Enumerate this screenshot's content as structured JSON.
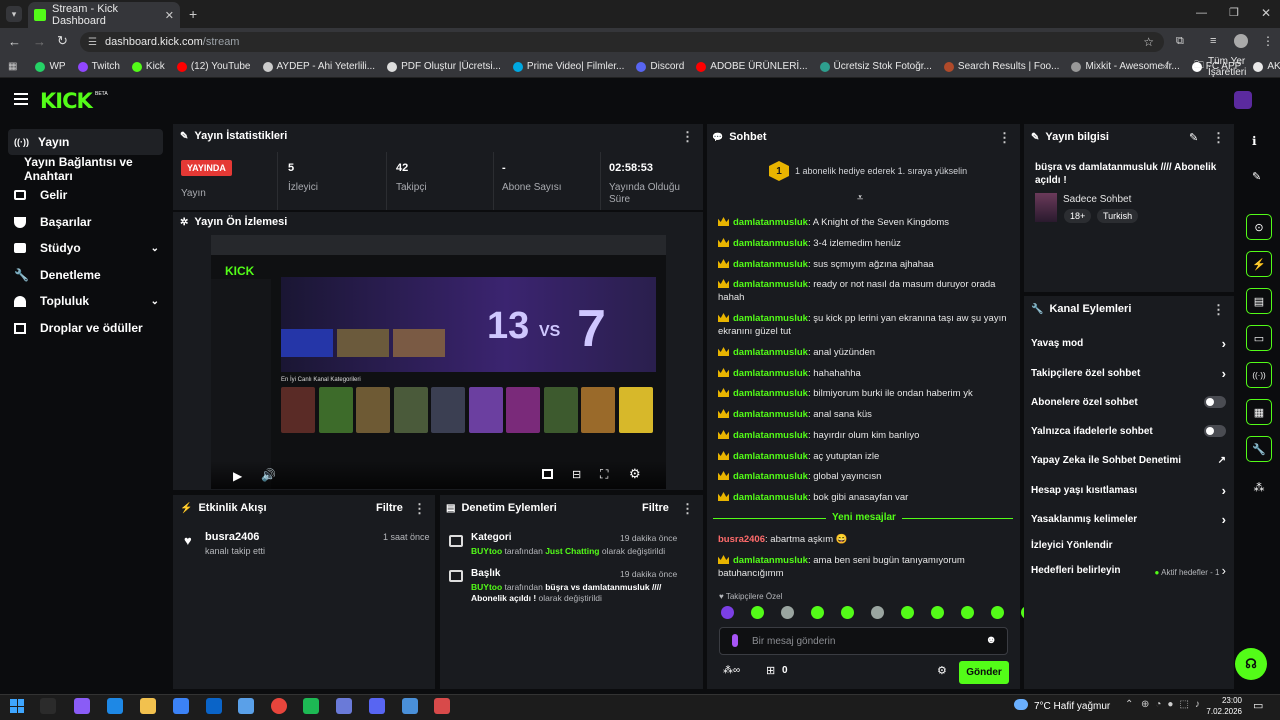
{
  "browser": {
    "tab_title": "Stream - Kick Dashboard",
    "url_domain": "dashboard.kick.com",
    "url_path": "/stream",
    "bookmarks": [
      {
        "label": "WP",
        "color": "#25d366"
      },
      {
        "label": "Twitch",
        "color": "#9146ff"
      },
      {
        "label": "Kick",
        "color": "#53fc18"
      },
      {
        "label": "(12) YouTube",
        "color": "#ff0000"
      },
      {
        "label": "AYDEP - Ahi Yeterlili...",
        "color": "#cccccc"
      },
      {
        "label": "PDF Oluştur |Ücretsi...",
        "color": "#dddddd"
      },
      {
        "label": "Prime Video| Filmler...",
        "color": "#00a8e1"
      },
      {
        "label": "Discord",
        "color": "#5865f2"
      },
      {
        "label": "ADOBE ÜRÜNLERİ...",
        "color": "#ff0000"
      },
      {
        "label": "Ücretsiz Stok Fotoğr...",
        "color": "#2e9e8e"
      },
      {
        "label": "Search Results | Foo...",
        "color": "#b04a2a"
      },
      {
        "label": "Mixkit - Awesome fr...",
        "color": "#999999"
      },
      {
        "label": "FC APP",
        "color": "#ffffff"
      },
      {
        "label": "AKNET",
        "color": "#e8e8e8"
      }
    ],
    "all_bookmarks": "Tüm Yer İşaretleri"
  },
  "brand": {
    "logo": "KICK",
    "beta": "BETA",
    "accent": "#53fc18"
  },
  "sidebar": {
    "items": [
      {
        "label": "Yayın",
        "icon": "broadcast-icon"
      },
      {
        "label": "Yayın Bağlantısı ve Anahtarı",
        "icon": ""
      },
      {
        "label": "Gelir",
        "icon": "revenue-icon"
      },
      {
        "label": "Başarılar",
        "icon": "trophy-icon"
      },
      {
        "label": "Stüdyo",
        "icon": "studio-icon"
      },
      {
        "label": "Denetleme",
        "icon": "wrench-icon"
      },
      {
        "label": "Topluluk",
        "icon": "community-icon"
      },
      {
        "label": "Droplar ve ödüller",
        "icon": "gift-icon"
      }
    ]
  },
  "stats": {
    "title": "Yayın İstatistikleri",
    "live_badge": "YAYINDA",
    "live_label": "Yayın",
    "items": [
      {
        "value": "5",
        "label": "İzleyici"
      },
      {
        "value": "42",
        "label": "Takipçi"
      },
      {
        "value": "-",
        "label": "Abone Sayısı"
      },
      {
        "value": "02:58:53",
        "label": "Yayında Olduğu Süre"
      }
    ]
  },
  "preview": {
    "title": "Yayın Ön İzlemesi",
    "scores": [
      "13",
      "7"
    ],
    "vs": "VS",
    "categories_heading": "En İyi Canlı Kanal Kategorileri"
  },
  "activity": {
    "title": "Etkinlik Akışı",
    "filter": "Filtre",
    "items": [
      {
        "user": "busra2406",
        "text": "kanalı takip etti",
        "time": "1 saat önce"
      }
    ]
  },
  "moderation": {
    "title": "Denetim Eylemleri",
    "filter": "Filtre",
    "items": [
      {
        "title": "Kategori",
        "time": "19 dakika önce",
        "user": "BUYtoo",
        "mid": " tarafından ",
        "value": "Just Chatting",
        "tail": " olarak değiştirildi"
      },
      {
        "title": "Başlık",
        "time": "19 dakika önce",
        "user": "BUYtoo",
        "mid": " tarafından ",
        "value": "büşra vs damlatanmusluk //// Abonelik açıldı !",
        "tail": " olarak değiştirildi"
      }
    ]
  },
  "chat": {
    "title": "Sohbet",
    "gift_rank": "1",
    "gift_banner": "1 abonelik hediye ederek 1. sıraya yükselin",
    "messages": [
      {
        "user": "damlatanmusluk",
        "text": ": A Knight of the Seven Kingdoms"
      },
      {
        "user": "damlatanmusluk",
        "text": ": 3-4 izlemedim henüz"
      },
      {
        "user": "damlatanmusluk",
        "text": ": sus sçmıyım ağzına ajhahaa"
      },
      {
        "user": "damlatanmusluk",
        "text": ": ready or not nasıl da masum duruyor orada hahah"
      },
      {
        "user": "damlatanmusluk",
        "text": ": şu kick pp lerini yan ekranına taşı aw şu yayın ekranını güzel tut"
      },
      {
        "user": "damlatanmusluk",
        "text": ": anal yüzünden"
      },
      {
        "user": "damlatanmusluk",
        "text": ": hahahahha"
      },
      {
        "user": "damlatanmusluk",
        "text": ": bilmiyorum burki ile ondan haberim yk"
      },
      {
        "user": "damlatanmusluk",
        "text": ": anal sana küs"
      },
      {
        "user": "damlatanmusluk",
        "text": ": hayırdır olum kim banlıyo"
      },
      {
        "user": "damlatanmusluk",
        "text": ": aç yutuptan izle"
      },
      {
        "user": "damlatanmusluk",
        "text": ": global yayıncısn"
      },
      {
        "user": "damlatanmusluk",
        "text": ": bok gibi anasayfan var"
      }
    ],
    "new_messages": "Yeni mesajlar",
    "new": [
      {
        "user": "busra2406",
        "text": ": abartma aşkım 😄"
      },
      {
        "user": "damlatanmusluk",
        "text": ": ama ben seni bugün tanıyamıyorum batuhancığımm"
      }
    ],
    "followers_only": "Takipçilere Özel",
    "placeholder": "Bir mesaj gönderin",
    "points": "0",
    "send": "Gönder"
  },
  "info": {
    "title": "Yayın bilgisi",
    "stream_title": "büşra vs damlatanmusluk //// Abonelik açıldı !",
    "category": "Sadece Sohbet",
    "tags": [
      "18+",
      "Turkish"
    ]
  },
  "actions": {
    "title": "Kanal Eylemleri",
    "items": [
      {
        "label": "Yavaş mod",
        "kind": "arrow"
      },
      {
        "label": "Takipçilere özel sohbet",
        "kind": "arrow"
      },
      {
        "label": "Abonelere özel sohbet",
        "kind": "toggle"
      },
      {
        "label": "Yalnızca ifadelerle sohbet",
        "kind": "toggle"
      },
      {
        "label": "Yapay Zeka ile Sohbet Denetimi",
        "kind": "external"
      },
      {
        "label": "Hesap yaşı kısıtlaması",
        "kind": "arrow"
      },
      {
        "label": "Yasaklanmış kelimeler",
        "kind": "arrow"
      },
      {
        "label": "İzleyici Yönlendir",
        "kind": "none"
      },
      {
        "label": "Hedefleri belirleyin",
        "kind": "goal",
        "extra": "Aktif hedefler - 1"
      }
    ]
  },
  "taskbar": {
    "weather": "7°C  Hafif yağmur",
    "time": "23:00",
    "date": "7.02.2026"
  }
}
